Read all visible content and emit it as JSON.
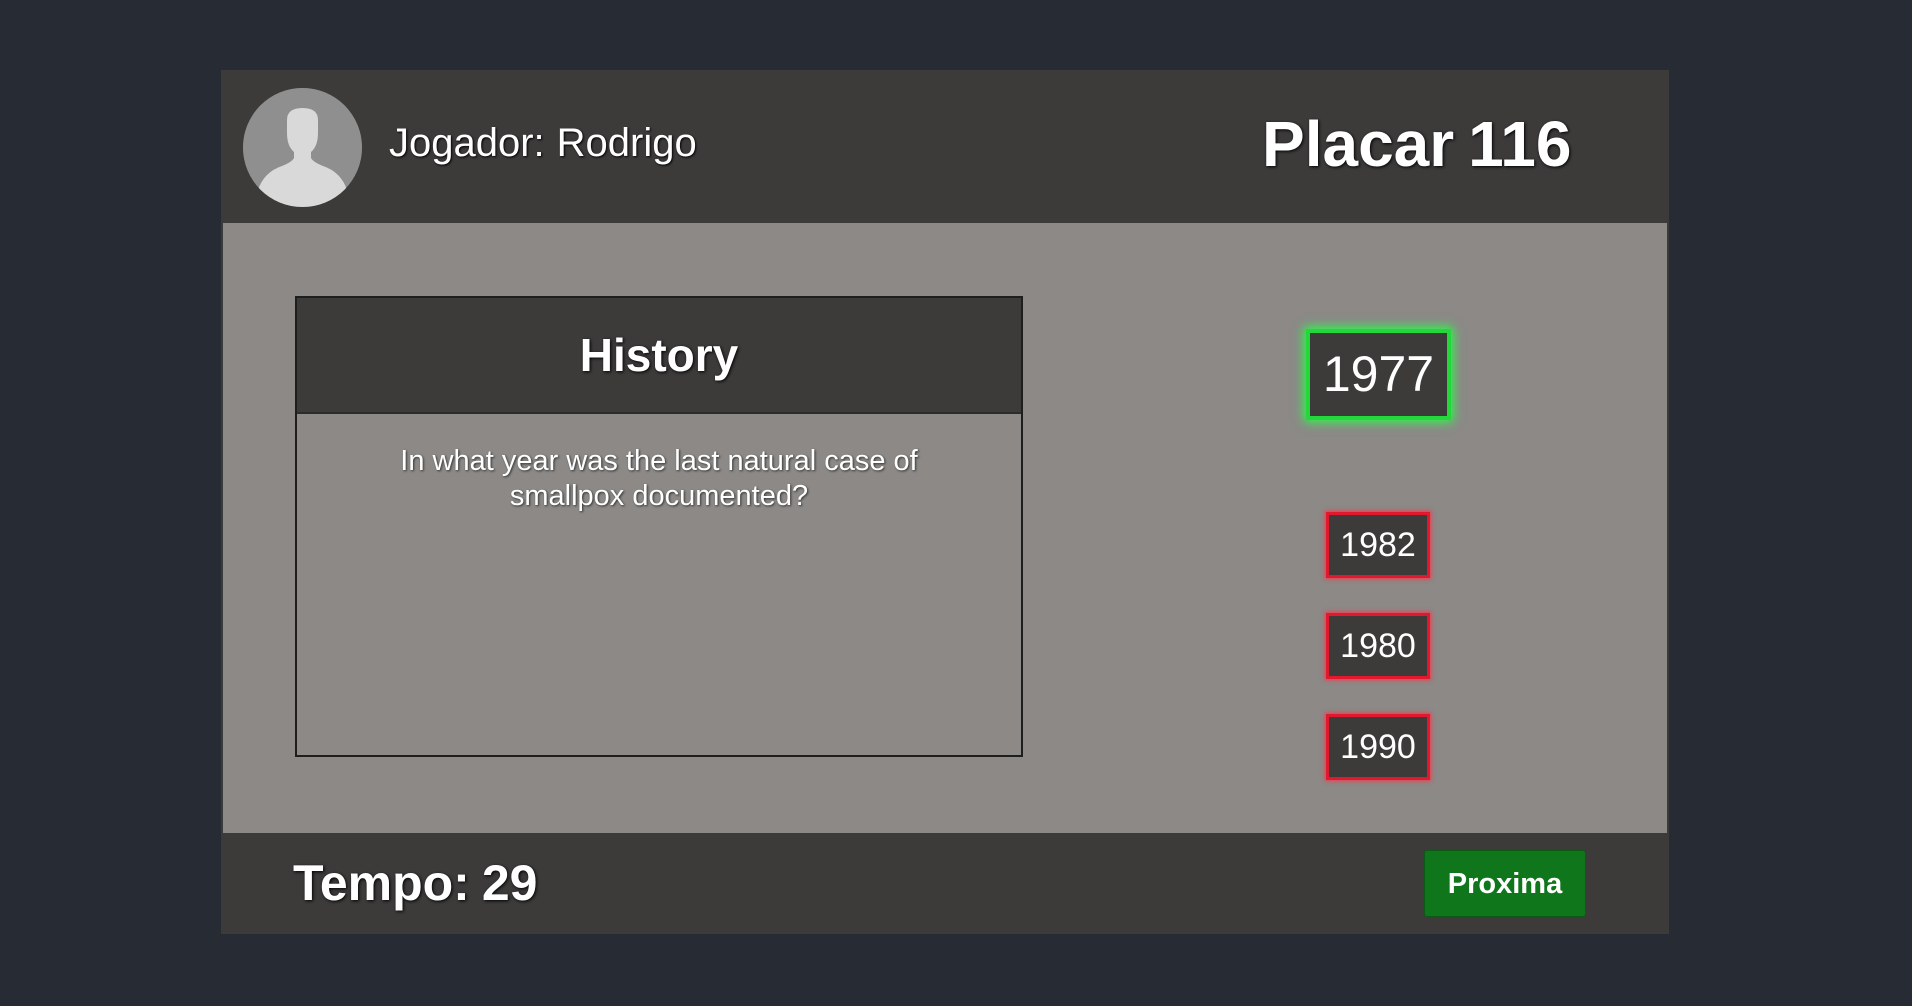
{
  "header": {
    "player_label": "Jogador:",
    "player_name": "Rodrigo",
    "score_label": "Placar",
    "score_value": "116"
  },
  "question": {
    "category": "History",
    "text": "In what year was the last natural case of smallpox documented?"
  },
  "answers": [
    {
      "label": "1977",
      "state": "correct"
    },
    {
      "label": "1982",
      "state": "wrong"
    },
    {
      "label": "1980",
      "state": "wrong"
    },
    {
      "label": "1990",
      "state": "wrong"
    }
  ],
  "footer": {
    "timer_label": "Tempo:",
    "timer_value": "29",
    "next_label": "Proxima"
  },
  "colors": {
    "page_background": "#272b34",
    "panel_dark": "#3d3b3a",
    "panel_gray": "#8c8987",
    "correct_border": "#22d83a",
    "wrong_border": "#e0192e",
    "next_button": "#10761c"
  },
  "icons": {
    "avatar": "user-silhouette-icon"
  }
}
